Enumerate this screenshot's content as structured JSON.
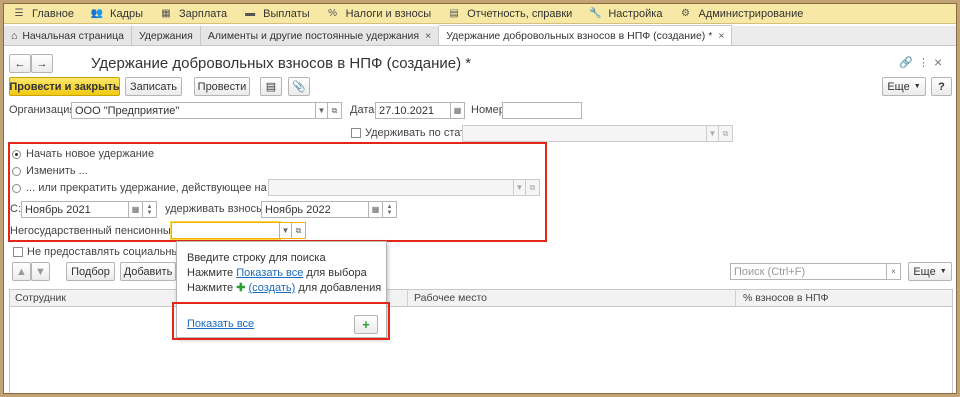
{
  "menu": [
    {
      "icon": "☰",
      "label": "Главное",
      "name": "menu-main"
    },
    {
      "icon": "👥",
      "label": "Кадры",
      "name": "menu-hr"
    },
    {
      "icon": "▦",
      "label": "Зарплата",
      "name": "menu-salary"
    },
    {
      "icon": "▬",
      "label": "Выплаты",
      "name": "menu-payments"
    },
    {
      "icon": "%",
      "label": "Налоги и взносы",
      "name": "menu-taxes"
    },
    {
      "icon": "▤",
      "label": "Отчетность, справки",
      "name": "menu-reports"
    },
    {
      "icon": "🔧",
      "label": "Настройка",
      "name": "menu-settings"
    },
    {
      "icon": "⚙",
      "label": "Администрирование",
      "name": "menu-admin"
    }
  ],
  "tabs": {
    "home": "Начальная страница",
    "t1": "Удержания",
    "t2": "Алименты и другие постоянные удержания",
    "t3": "Удержание добровольных взносов в НПФ (создание) *",
    "close": "×"
  },
  "header": {
    "title": "Удержание добровольных взносов в НПФ (создание) *",
    "back": "←",
    "fwd": "→",
    "link_icon": "🔗",
    "more": "⋮",
    "close": "×"
  },
  "toolbar": {
    "post_close": "Провести и закрыть",
    "save": "Записать",
    "post": "Провести",
    "more": "Еще",
    "help": "?"
  },
  "form": {
    "org_label": "Организация:",
    "org_value": "ООО \"Предприятие\"",
    "date_label": "Дата:",
    "date_value": "27.10.2021",
    "number_label": "Номер:",
    "number_value": "",
    "by_article_label": "Удерживать по статье:",
    "radio_new": "Начать новое удержание",
    "radio_change": "Изменить ...",
    "radio_stop": "... или прекратить удержание, действующее на основании",
    "from_label": "С:",
    "from_value": "Ноябрь 2021",
    "until_label": "удерживать взносы по:",
    "until_value": "Ноябрь 2022",
    "fund_label": "Негосударственный пенсионный фонд:",
    "fund_value": "",
    "no_deduction_label": "Не предоставлять социальный вычет"
  },
  "popup": {
    "hint": "Введите строку для поиска",
    "line2_pre": "Нажмите ",
    "line2_link": "Показать все",
    "line2_post": " для выбора",
    "line3_pre": "Нажмите ",
    "line3_link": "(создать)",
    "line3_post": " для добавления",
    "show_all": "Показать все",
    "add": "+"
  },
  "table": {
    "select": "Подбор",
    "add": "Добавить",
    "search_placeholder": "Поиск (Ctrl+F)",
    "more": "Еще",
    "columns": [
      "Сотрудник",
      "Рабочее место",
      "% взносов в НПФ"
    ]
  },
  "colors": {
    "highlight": "#e3261b",
    "menu_bg": "#f7e9a5",
    "primary": "#f1c911"
  }
}
